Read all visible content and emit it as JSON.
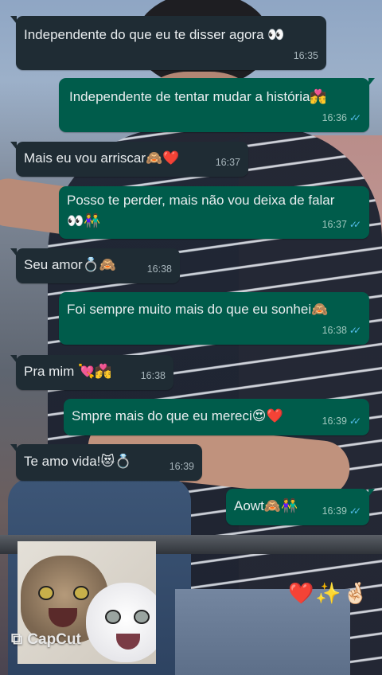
{
  "messages": [
    {
      "text": "Independente do que eu te disser agora 👀",
      "time": "16:35",
      "direction": "in"
    },
    {
      "text": "Independente de tentar mudar a história💏",
      "time": "16:36",
      "direction": "out",
      "read": true
    },
    {
      "text": "Mais eu vou arriscar🙈❤️",
      "time": "16:37",
      "direction": "in"
    },
    {
      "text_line1": "Posso te perder, mais não vou deixa de falar",
      "text_line2": "👀👫",
      "time": "16:37",
      "direction": "out",
      "read": true
    },
    {
      "text": "Seu amor💍🙈",
      "time": "16:38",
      "direction": "in"
    },
    {
      "text": "Foi sempre muito mais do que eu sonhei🙈",
      "time": "16:38",
      "direction": "out",
      "read": true
    },
    {
      "text": "Pra mim 💘💏",
      "time": "16:38",
      "direction": "in"
    },
    {
      "text": "Smpre mais do que eu mereci😍❤️",
      "time": "16:39",
      "direction": "out",
      "read": true
    },
    {
      "text": "Te amo vida!😻💍",
      "time": "16:39",
      "direction": "in"
    },
    {
      "text": "Aowt🙈👫",
      "time": "16:39",
      "direction": "out",
      "read": true
    }
  ],
  "read_ticks": "✓✓",
  "emoji_reaction": "❤️✨🤞🏻",
  "watermark": {
    "icon": "capcut-logo-icon",
    "label": "CapCut"
  },
  "colors": {
    "incoming_bubble": "#1f2c34",
    "outgoing_bubble": "#005c4b",
    "read_tick": "#53bdeb"
  }
}
